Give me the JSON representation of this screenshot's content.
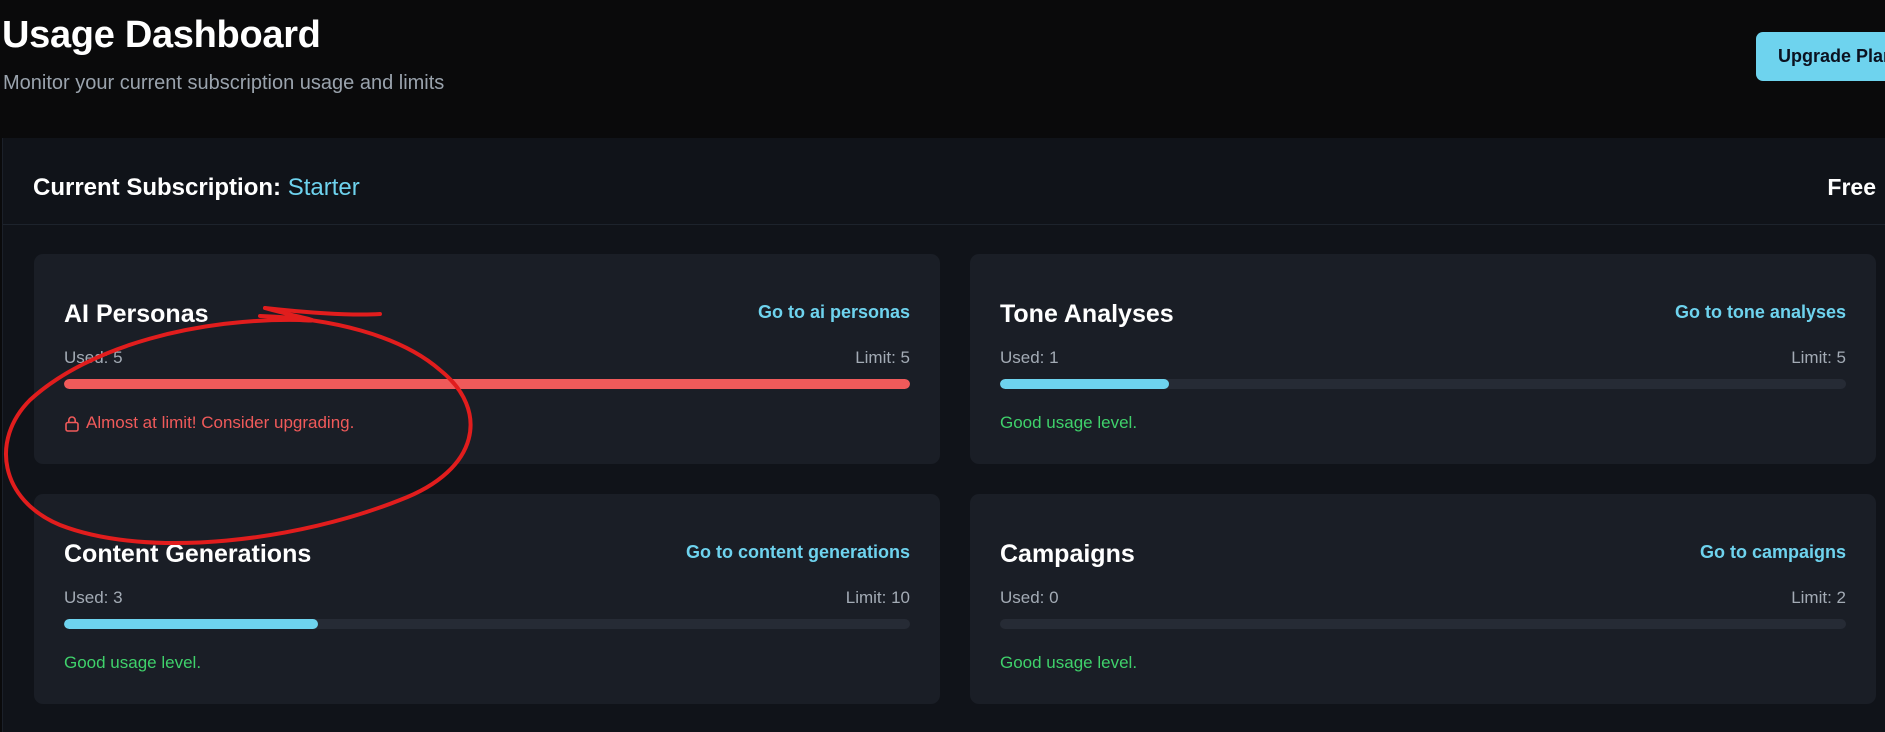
{
  "header": {
    "title": "Usage Dashboard",
    "subtitle": "Monitor your current subscription usage and limits",
    "upgrade_label": "Upgrade Plan"
  },
  "subscription": {
    "label": "Current Subscription:",
    "plan": "Starter",
    "price": "Free"
  },
  "colors": {
    "accent": "#6ed3ee",
    "good": "#3fd16b",
    "warn": "#f05a5a",
    "annotation": "#e11d1d"
  },
  "cards": [
    {
      "title": "AI Personas",
      "link": "Go to ai personas",
      "used_text": "Used: 5",
      "limit_text": "Limit: 5",
      "used": 5,
      "limit": 5,
      "status": "Almost at limit! Consider upgrading.",
      "status_type": "warn",
      "status_icon": "lock-icon"
    },
    {
      "title": "Tone Analyses",
      "link": "Go to tone analyses",
      "used_text": "Used: 1",
      "limit_text": "Limit: 5",
      "used": 1,
      "limit": 5,
      "status": "Good usage level.",
      "status_type": "good"
    },
    {
      "title": "Content Generations",
      "link": "Go to content generations",
      "used_text": "Used: 3",
      "limit_text": "Limit: 10",
      "used": 3,
      "limit": 10,
      "status": "Good usage level.",
      "status_type": "good"
    },
    {
      "title": "Campaigns",
      "link": "Go to campaigns",
      "used_text": "Used: 0",
      "limit_text": "Limit: 2",
      "used": 0,
      "limit": 2,
      "status": "Good usage level.",
      "status_type": "good"
    }
  ]
}
